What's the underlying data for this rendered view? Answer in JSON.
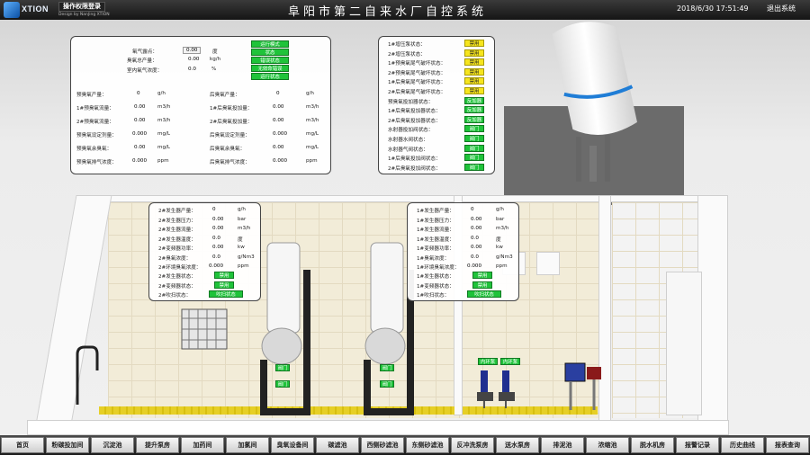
{
  "header": {
    "logo_text": "XTION",
    "login_label": "操作权限登录",
    "design_credit": "Design by NanJing XTION",
    "title": "阜阳市第二自来水厂自控系统",
    "datetime": "2018/6/30 17:51:49",
    "logout_label": "退出系统"
  },
  "panel_top_left": {
    "rows": [
      {
        "label": "氧气露点：",
        "value": "0.00",
        "unit": "度"
      },
      {
        "label": "臭氧总产量：",
        "value": "0.00",
        "unit": "kg/h"
      },
      {
        "label": "室内氧气浓度：",
        "value": "0.0",
        "unit": "%"
      }
    ],
    "buttons": [
      "运行模式",
      "状态",
      "错误状态",
      "无效命错误",
      "运行状态"
    ],
    "left_rows": [
      {
        "label": "预臭氧产量：",
        "value": "0",
        "unit": "g/h"
      },
      {
        "label": "1#预臭氧流量：",
        "value": "0.00",
        "unit": "m3/h"
      },
      {
        "label": "2#预臭氧流量：",
        "value": "0.00",
        "unit": "m3/h"
      },
      {
        "label": "预臭氧设定剂量：",
        "value": "0.000",
        "unit": "mg/L"
      },
      {
        "label": "预臭氧余臭氧：",
        "value": "0.00",
        "unit": "mg/L"
      },
      {
        "label": "预臭氧排气浓度：",
        "value": "0.000",
        "unit": "ppm"
      }
    ],
    "right_rows": [
      {
        "label": "后臭氧产量：",
        "value": "0",
        "unit": "g/h"
      },
      {
        "label": "1#后臭氧投加量：",
        "value": "0.00",
        "unit": "m3/h"
      },
      {
        "label": "2#后臭氧投加量：",
        "value": "0.00",
        "unit": "m3/h"
      },
      {
        "label": "后臭氧设定剂量：",
        "value": "0.000",
        "unit": "mg/L"
      },
      {
        "label": "后臭氧余臭氧：",
        "value": "0.00",
        "unit": "mg/L"
      },
      {
        "label": "后臭氧排气浓度：",
        "value": "0.000",
        "unit": "ppm"
      }
    ]
  },
  "panel_top_right": {
    "rows": [
      {
        "label": "1#增压泵状态：",
        "state": "禁用",
        "color": "yellow"
      },
      {
        "label": "2#增压泵状态：",
        "state": "禁用",
        "color": "yellow"
      },
      {
        "label": "1#预臭氧尾气破坏状态：",
        "state": "禁用",
        "color": "yellow"
      },
      {
        "label": "2#预臭氧尾气破坏状态：",
        "state": "禁用",
        "color": "yellow"
      },
      {
        "label": "1#后臭氧尾气破坏状态：",
        "state": "禁用",
        "color": "yellow"
      },
      {
        "label": "2#后臭氧尾气破坏状态：",
        "state": "禁用",
        "color": "yellow"
      },
      {
        "label": "预臭氧投加器状态：",
        "state": "反加器",
        "color": "green"
      },
      {
        "label": "1#后臭氧投加器状态：",
        "state": "反加器",
        "color": "green"
      },
      {
        "label": "2#后臭氧投加器状态：",
        "state": "反加器",
        "color": "green"
      },
      {
        "label": "水射器投加阀状态：",
        "state": "阀门",
        "color": "green"
      },
      {
        "label": "水射器水阀状态：",
        "state": "阀门",
        "color": "green"
      },
      {
        "label": "水射器气阀状态：",
        "state": "阀门",
        "color": "green"
      },
      {
        "label": "1#后臭氧投加阀状态：",
        "state": "阀门",
        "color": "green"
      },
      {
        "label": "2#后臭氧投加阀状态：",
        "state": "阀门",
        "color": "green"
      }
    ]
  },
  "generator_2": {
    "rows": [
      {
        "label": "2#发生器产量：",
        "value": "0",
        "unit": "g/h"
      },
      {
        "label": "2#发生器压力：",
        "value": "0.00",
        "unit": "bar"
      },
      {
        "label": "2#发生器流量：",
        "value": "0.00",
        "unit": "m3/h"
      },
      {
        "label": "2#发生器温度：",
        "value": "0.0",
        "unit": "度"
      },
      {
        "label": "2#变频器功率：",
        "value": "0.00",
        "unit": "kw"
      },
      {
        "label": "2#臭氧浓度：",
        "value": "0.0",
        "unit": "g/Nm3"
      },
      {
        "label": "2#环境臭氧浓度：",
        "value": "0.000",
        "unit": "ppm"
      }
    ],
    "status_rows": [
      {
        "label": "2#发生器状态：",
        "state": "禁用"
      },
      {
        "label": "2#变频器状态：",
        "state": "禁用"
      },
      {
        "label": "2#吹扫状态：",
        "state": "吹扫状态"
      }
    ]
  },
  "generator_1": {
    "rows": [
      {
        "label": "1#发生器产量：",
        "value": "0",
        "unit": "g/h"
      },
      {
        "label": "1#发生器压力：",
        "value": "0.00",
        "unit": "bar"
      },
      {
        "label": "1#发生器流量：",
        "value": "0.00",
        "unit": "m3/h"
      },
      {
        "label": "1#发生器温度：",
        "value": "0.0",
        "unit": "度"
      },
      {
        "label": "1#变频器功率：",
        "value": "0.00",
        "unit": "kw"
      },
      {
        "label": "1#臭氧浓度：",
        "value": "0.0",
        "unit": "g/Nm3"
      },
      {
        "label": "1#环境臭氧浓度：",
        "value": "0.000",
        "unit": "ppm"
      }
    ],
    "status_rows": [
      {
        "label": "1#发生器状态：",
        "state": "禁用"
      },
      {
        "label": "1#变频器状态：",
        "state": "禁用"
      },
      {
        "label": "1#吹扫状态：",
        "state": "吹扫状态"
      }
    ]
  },
  "scene_labels": {
    "valve": "阀门",
    "inner_loop": "内环泵"
  },
  "nav": [
    "首页",
    "粉碳投加间",
    "沉淀池",
    "提升泵房",
    "加药间",
    "加氯间",
    "臭氧设备间",
    "碳滤池",
    "西侧砂滤池",
    "东侧砂滤池",
    "反冲洗泵房",
    "送水泵房",
    "排泥池",
    "浓缩池",
    "脱水机房",
    "报警记录",
    "历史曲线",
    "报表查询"
  ]
}
